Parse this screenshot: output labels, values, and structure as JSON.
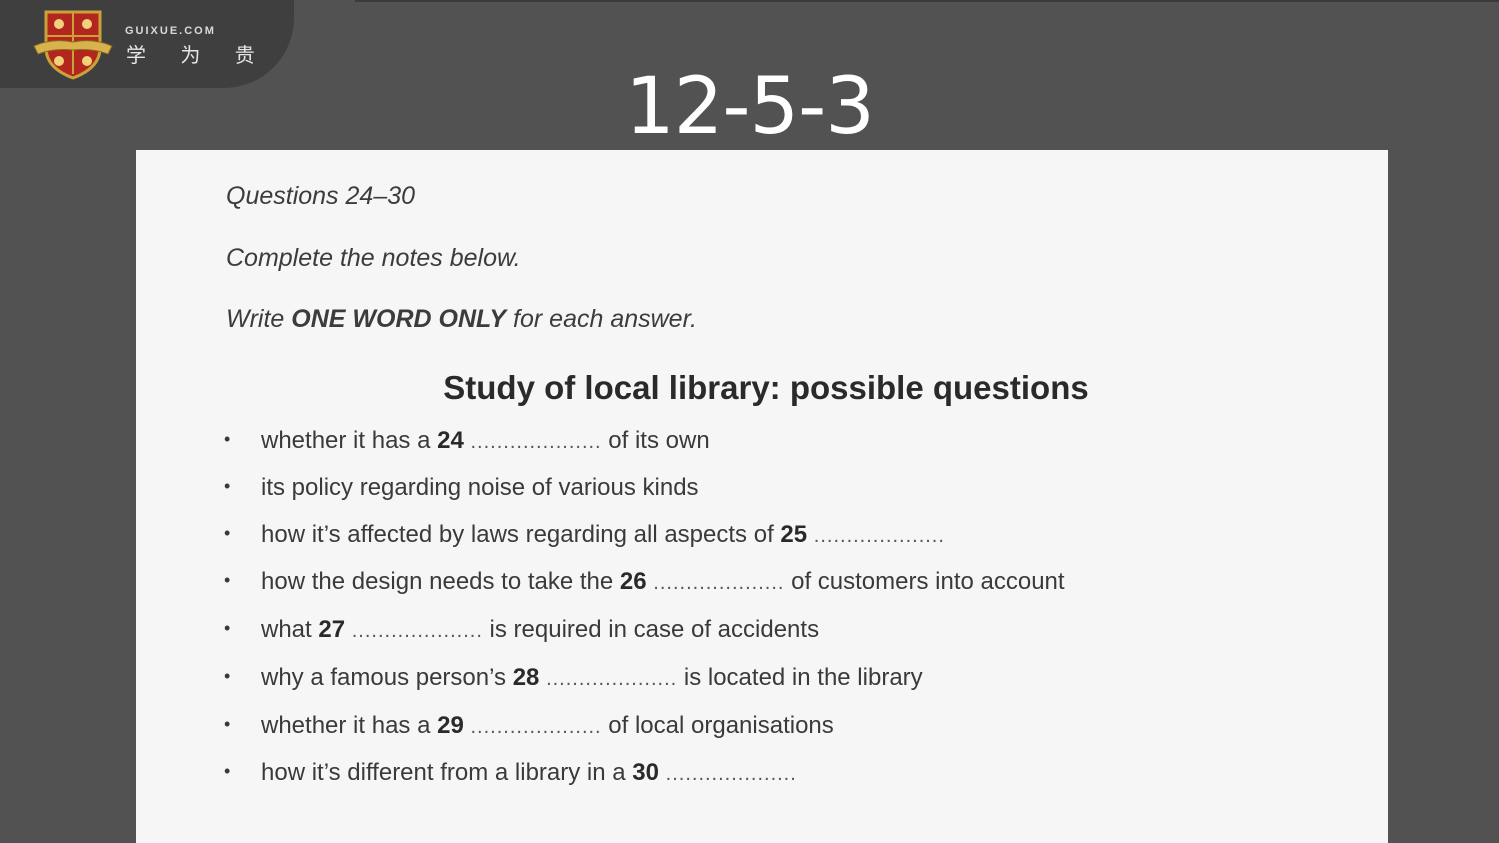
{
  "logo": {
    "name_en": "GUIXUE.COM",
    "name_cn": "学 为 贵"
  },
  "slide": {
    "title": "12-5-3"
  },
  "document": {
    "questions_label": "Questions 24–30",
    "instruction_1": "Complete the notes below.",
    "instruction_2_pre": "Write ",
    "instruction_2_bold": "ONE WORD ONLY",
    "instruction_2_post": " for each answer.",
    "heading": "Study of local library: possible questions",
    "blank": "....................",
    "items": [
      {
        "before": "whether it has a ",
        "num": "24",
        "after": " of its own"
      },
      {
        "before": "its policy regarding noise of various kinds",
        "num": "",
        "after": ""
      },
      {
        "before": "how it’s affected by laws regarding all aspects of ",
        "num": "25",
        "after": ""
      },
      {
        "before": "how the design needs to take the ",
        "num": "26",
        "after": " of customers into account"
      },
      {
        "before": "what ",
        "num": "27",
        "after": " is required in case of accidents"
      },
      {
        "before": "why a famous person’s ",
        "num": "28",
        "after": " is located in the library"
      },
      {
        "before": "whether it has a ",
        "num": "29",
        "after": " of local organisations"
      },
      {
        "before": "how it’s different from a library in a ",
        "num": "30",
        "after": ""
      }
    ]
  },
  "colors": {
    "background": "#525252",
    "paper": "#f6f6f6",
    "shield_red": "#b3261e",
    "shield_gold": "#c9a23a"
  }
}
